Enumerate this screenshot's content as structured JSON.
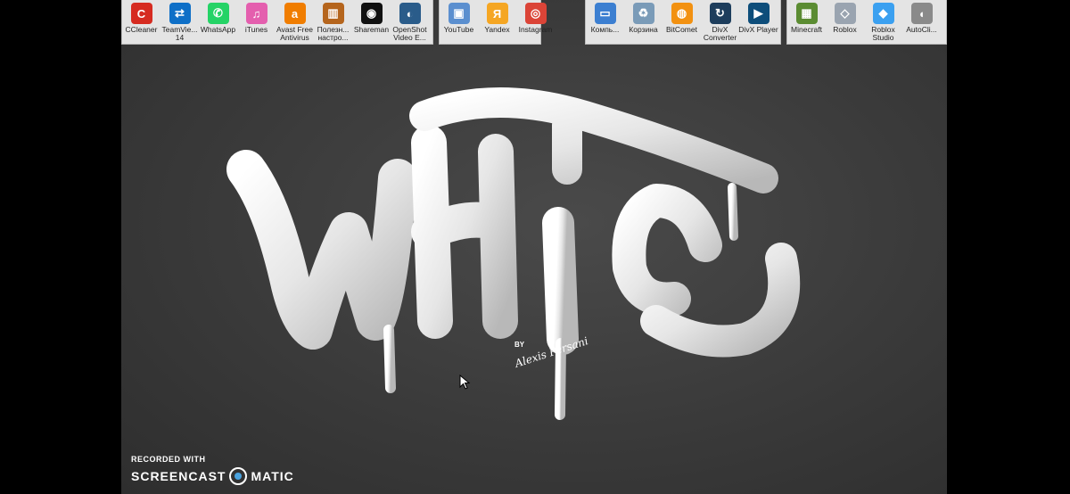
{
  "toolbars": [
    {
      "items": [
        {
          "label": "CCleaner",
          "icon": "ccleaner-icon",
          "color": "#d62b20",
          "glyph": "C"
        },
        {
          "label": "TeamVie... 14",
          "icon": "teamviewer-icon",
          "color": "#0e6fc7",
          "glyph": "⇄"
        },
        {
          "label": "WhatsApp",
          "icon": "whatsapp-icon",
          "color": "#25d366",
          "glyph": "✆"
        },
        {
          "label": "iTunes",
          "icon": "itunes-icon",
          "color": "#e45fae",
          "glyph": "♫"
        },
        {
          "label": "Avast Free Antivirus",
          "icon": "avast-icon",
          "color": "#f07d00",
          "glyph": "a"
        },
        {
          "label": "Полезн... настро...",
          "icon": "folder-icon",
          "color": "#b5651d",
          "glyph": "▥"
        },
        {
          "label": "Shareman",
          "icon": "shareman-icon",
          "color": "#111111",
          "glyph": "◉"
        },
        {
          "label": "OpenShot Video E...",
          "icon": "openshot-icon",
          "color": "#2a5c8a",
          "glyph": "◐"
        }
      ]
    },
    {
      "items": [
        {
          "label": "YouTube",
          "icon": "youtube-icon",
          "color": "#5b8fcf",
          "glyph": "▣"
        },
        {
          "label": "Yandex",
          "icon": "yandex-icon",
          "color": "#f5a623",
          "glyph": "Я"
        },
        {
          "label": "Instagram",
          "icon": "chrome-icon",
          "color": "#db4437",
          "glyph": "◎"
        }
      ]
    },
    {
      "items": [
        {
          "label": "Компь...",
          "icon": "computer-icon",
          "color": "#3c7fd1",
          "glyph": "▭"
        },
        {
          "label": "Корзина",
          "icon": "recycle-bin-icon",
          "color": "#7a9bb8",
          "glyph": "♻"
        },
        {
          "label": "BitComet",
          "icon": "bitcomet-icon",
          "color": "#f29111",
          "glyph": "◍"
        },
        {
          "label": "DivX Converter",
          "icon": "divx-converter-icon",
          "color": "#1d3d5c",
          "glyph": "↻"
        },
        {
          "label": "DivX Player",
          "icon": "divx-player-icon",
          "color": "#0d4d7a",
          "glyph": "▶"
        }
      ]
    },
    {
      "items": [
        {
          "label": "Minecraft",
          "icon": "minecraft-icon",
          "color": "#5b8c32",
          "glyph": "▦"
        },
        {
          "label": "Roblox",
          "icon": "roblox-icon",
          "color": "#9aa4b0",
          "glyph": "◇"
        },
        {
          "label": "Roblox Studio",
          "icon": "roblox-studio-icon",
          "color": "#3ba0f0",
          "glyph": "◆"
        },
        {
          "label": "AutoCli...",
          "icon": "mouse-icon",
          "color": "#8a8a8a",
          "glyph": "◖"
        }
      ]
    }
  ],
  "artwork": {
    "word": "White",
    "byline": "BY",
    "signature": "Alexis Persani"
  },
  "watermark": {
    "line1": "RECORDED WITH",
    "brand_left": "SCREENCAST",
    "brand_right": "MATIC"
  }
}
